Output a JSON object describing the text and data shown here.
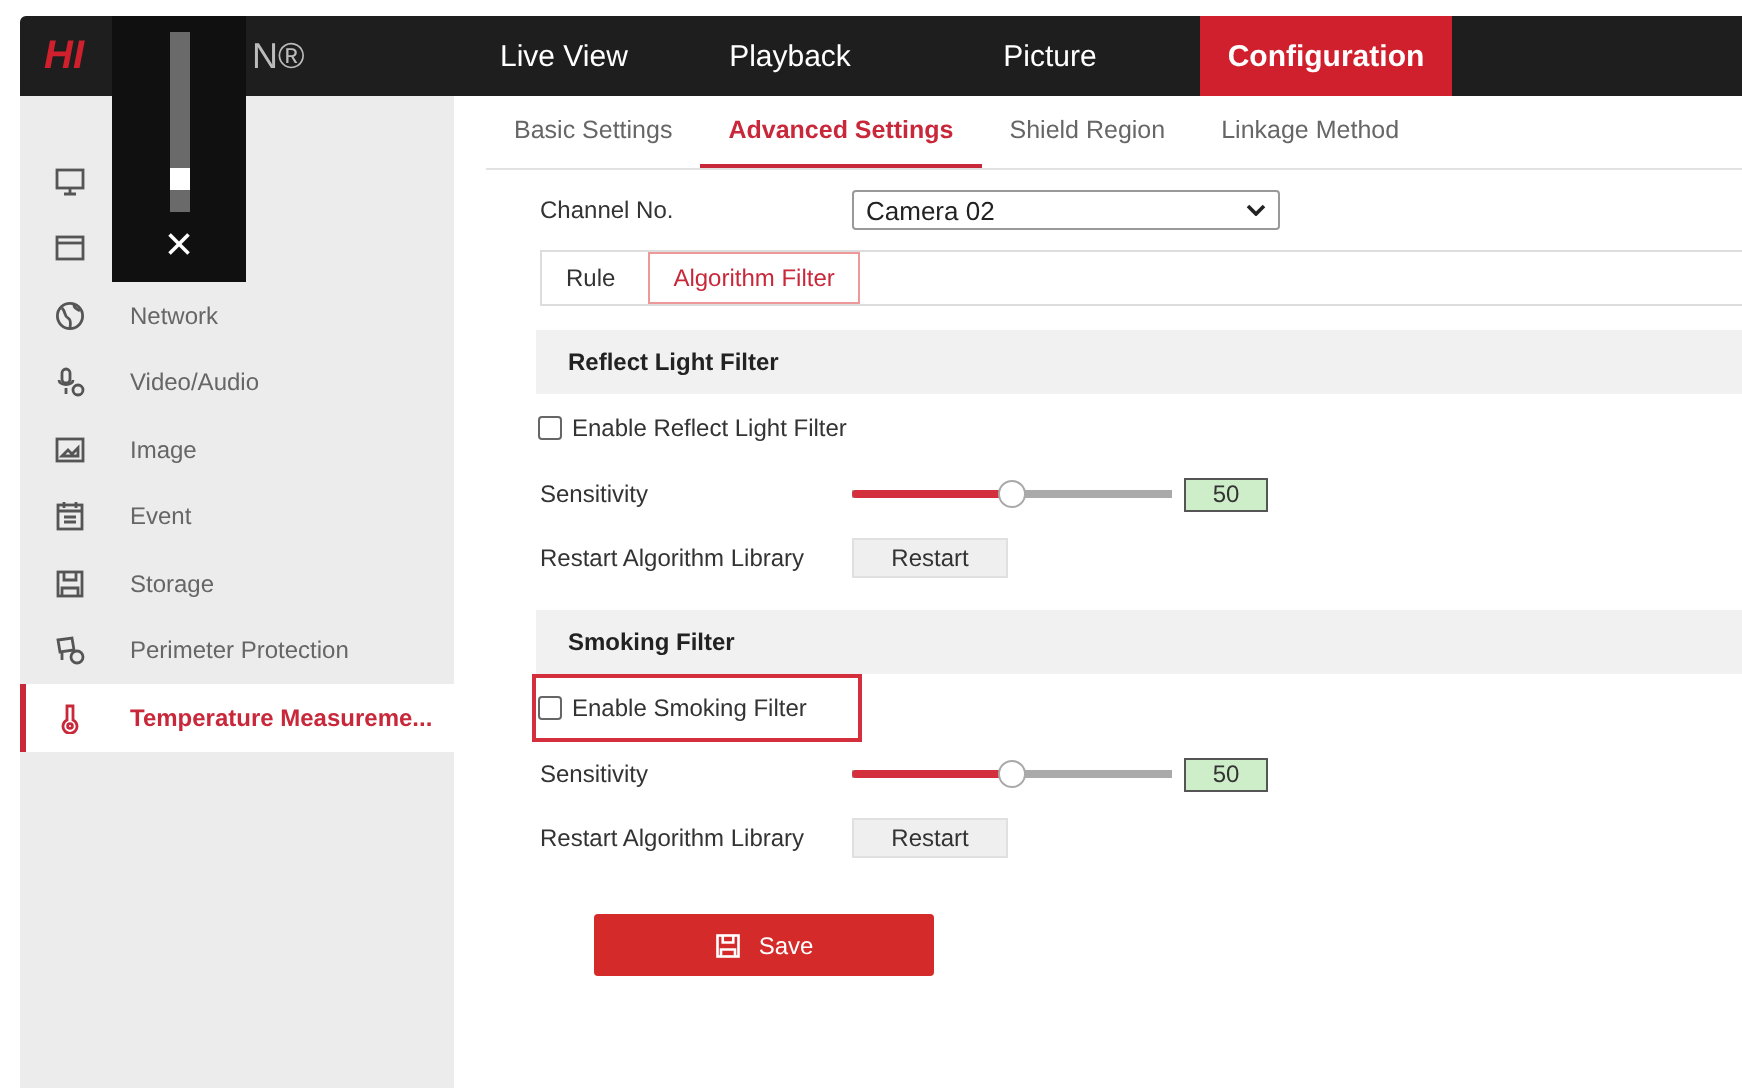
{
  "header": {
    "logo_left": "HI",
    "logo_right": "N®",
    "nav": [
      {
        "label": "Live View",
        "selected": false
      },
      {
        "label": "Playback",
        "selected": false
      },
      {
        "label": "Picture",
        "selected": false
      },
      {
        "label": "Configuration",
        "selected": true
      }
    ]
  },
  "volume_popup": {
    "level": 0.12,
    "close": "×"
  },
  "sidebar": {
    "items": [
      {
        "selected": false
      },
      {
        "selected": false
      },
      {
        "label": "Network",
        "selected": false
      },
      {
        "label": "Video/Audio",
        "selected": false
      },
      {
        "label": "Image",
        "selected": false
      },
      {
        "label": "Event",
        "selected": false
      },
      {
        "label": "Storage",
        "selected": false
      },
      {
        "label": "Perimeter Protection",
        "selected": false
      },
      {
        "label": "Temperature Measureme...",
        "selected": true
      }
    ]
  },
  "tabs": [
    {
      "label": "Basic Settings",
      "selected": false
    },
    {
      "label": "Advanced Settings",
      "selected": true
    },
    {
      "label": "Shield Region",
      "selected": false
    },
    {
      "label": "Linkage Method",
      "selected": false
    }
  ],
  "channel": {
    "label": "Channel No.",
    "value": "Camera 02"
  },
  "steps": [
    {
      "label": "Rule",
      "selected": false
    },
    {
      "label": "Algorithm Filter",
      "selected": true
    }
  ],
  "sections": [
    {
      "title": "Reflect Light Filter",
      "enable": {
        "label": "Enable Reflect Light Filter",
        "checked": false,
        "highlighted": false
      },
      "sensitivity": {
        "label": "Sensitivity",
        "level": 0.5,
        "reading": "50"
      },
      "restart": {
        "label": "Restart Algorithm Library",
        "button": "Restart"
      }
    },
    {
      "title": "Smoking Filter",
      "enable": {
        "label": "Enable Smoking Filter",
        "checked": false,
        "highlighted": true
      },
      "sensitivity": {
        "label": "Sensitivity",
        "level": 0.5,
        "reading": "50"
      },
      "restart": {
        "label": "Restart Algorithm Library",
        "button": "Restart"
      }
    }
  ],
  "save_button": "Save"
}
